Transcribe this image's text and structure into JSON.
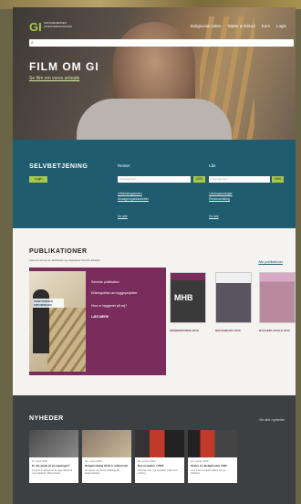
{
  "header": {
    "logo": "GI",
    "logo_sub": "GRUNDEJERNES INVESTERINGSFOND",
    "nav": [
      "Boligsocial viden",
      "Støtte & tilskud",
      "Kurs",
      "Login"
    ]
  },
  "hero": {
    "title": "FILM OM GI",
    "link": "Se film om vores arbejde"
  },
  "self_service": {
    "heading": "SELVBETJENING",
    "login": "Login",
    "col1": {
      "heading": "Renter",
      "placeholder": "Søg ejendom",
      "go": "SØG",
      "links": [
        "Udbetalingsindex",
        "Ansøgningsblanketter"
      ],
      "more": "Se alle"
    },
    "col2": {
      "heading": "Lån",
      "placeholder": "Søg ejendom",
      "go": "SØG",
      "links": [
        "Låneoplysninger",
        "Renteudvikling"
      ],
      "more": "Se alle"
    }
  },
  "publications": {
    "heading": "PUBLIKATIONER",
    "subtitle": "Læs om GI og om aktiviteter og udgivelser fra GI's arbejde",
    "see_all": "Alle publikationer",
    "featured": {
      "cover_title": "OMBYGNINGS ERFARINGER",
      "lines": [
        "Seneste publikation",
        "Erfaringsblad om byggeprojekter",
        "Hvor er byggeriet på vej?",
        "LÆS MERE"
      ]
    },
    "books": [
      {
        "cover": "MHB",
        "caption": "ÅRSBERETNING 2018"
      },
      {
        "cover": "",
        "caption": "BOLIGBEHOV 2019"
      },
      {
        "cover": "",
        "caption": "BYGGERI AFTALE 2019"
      }
    ]
  },
  "news": {
    "heading": "NYHEDER",
    "see_all": "Se alle nyheder",
    "items": [
      {
        "date": "07. april 2020",
        "title": "Er der plads til ansøgninger?",
        "text": "GI giver mulighed for at søge tilskud til nye projekter i løbet af året."
      },
      {
        "date": "02. marts 2020",
        "title": "Boligmodning 2019 er udkommet",
        "text": "Se status over årets udvikling på boligmarkedet."
      },
      {
        "date": "28. januar 2020",
        "title": "Nye projekter i 2020",
        "text": "Oversigt over nye projekter under GI's ordning."
      },
      {
        "date": "14. januar 2020",
        "title": "Status for Boligfonden 2020",
        "text": "Læs mere om årets status og nye initiativer."
      }
    ]
  }
}
